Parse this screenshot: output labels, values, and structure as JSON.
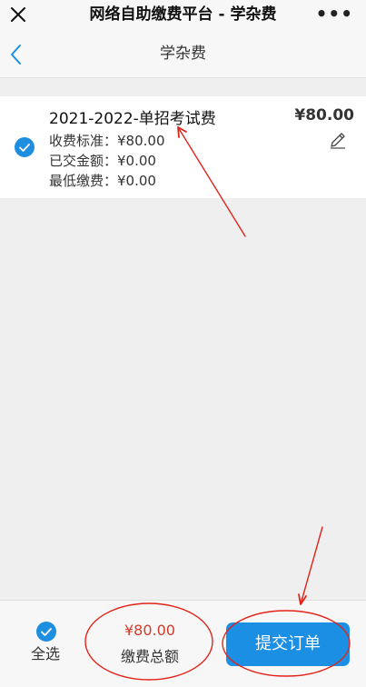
{
  "window": {
    "title": "网络自助缴费平台 - 学杂费",
    "more_label": "•••",
    "close_icon": "close-icon"
  },
  "header": {
    "title": "学杂费",
    "back_icon": "chevron-left-icon"
  },
  "fee_item": {
    "selected": true,
    "title": "2021-2022-单招考试费",
    "amount": "¥80.00",
    "standard": "收费标准：¥80.00",
    "paid": "已交金额：¥0.00",
    "minimum": "最低缴费：¥0.00",
    "edit_icon": "pencil-icon"
  },
  "footer": {
    "select_all_label": "全选",
    "total_amount": "¥80.00",
    "total_label": "缴费总额",
    "submit_label": "提交订单"
  },
  "colors": {
    "accent": "#1e8fe0",
    "price_red": "#d23c2a",
    "annotation_red": "#e2231a"
  }
}
